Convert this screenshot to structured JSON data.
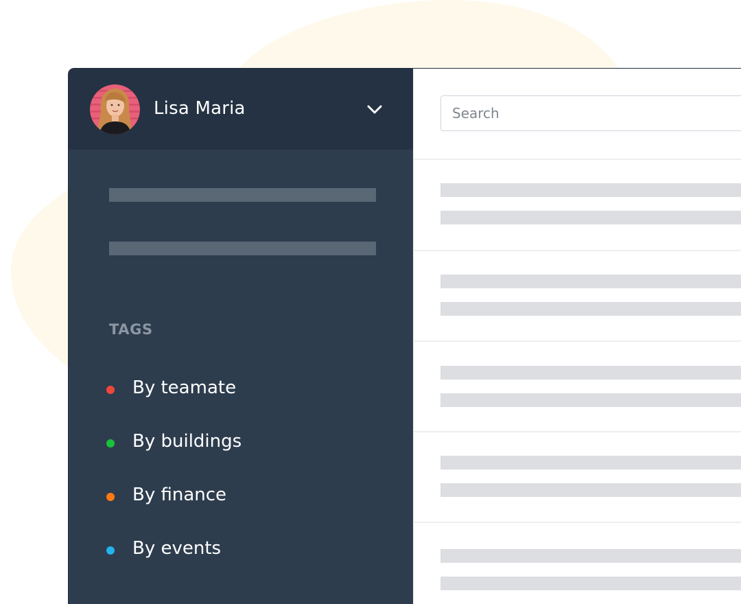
{
  "user": {
    "name": "Lisa Maria"
  },
  "sidebar": {
    "tags_heading": "TAGS",
    "tags": [
      {
        "label": "By teamate",
        "color": "#f0463a"
      },
      {
        "label": "By buildings",
        "color": "#18c23a"
      },
      {
        "label": "By finance",
        "color": "#ff7a12"
      },
      {
        "label": "By events",
        "color": "#22b4ee"
      }
    ]
  },
  "search": {
    "placeholder": "Search",
    "value": ""
  },
  "colors": {
    "sidebar_bg": "#2e3d4e",
    "sidebar_header_bg": "#243243",
    "blob": "#fff9ec"
  }
}
